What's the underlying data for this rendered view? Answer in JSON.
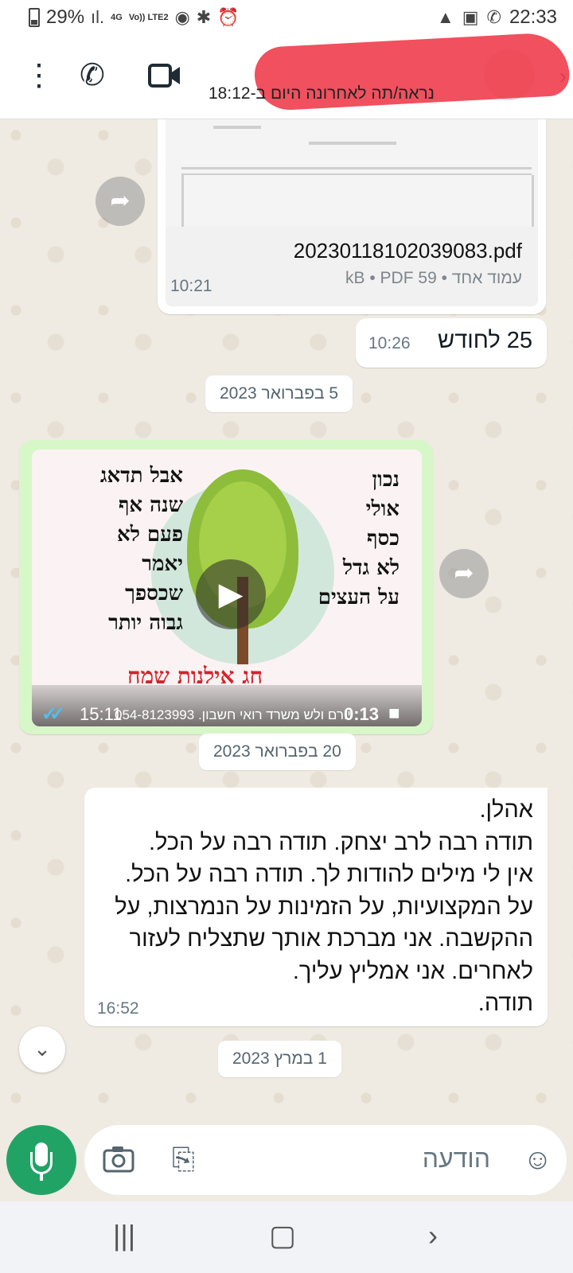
{
  "status": {
    "battery": "29%",
    "network": "4G",
    "volte": "Vo)) LTE2",
    "time": "22:33"
  },
  "header": {
    "last_seen": "נראה/תה לאחרונה היום ב-18:12"
  },
  "messages": {
    "pdf": {
      "filename": "20230118102039083.pdf",
      "info": "עמוד אחד • 59 kB • PDF",
      "time": "10:21"
    },
    "m25": {
      "text": "25 לחודש",
      "time": "10:26"
    },
    "date1": "5 בפברואר 2023",
    "video": {
      "duration": "0:13",
      "info": "יורם ולש משרד רואי חשבון. 054-8123993",
      "time": "15:11",
      "text_right": [
        "נכון",
        "אולי",
        "כסף",
        "לא גדל",
        "על העצים"
      ],
      "text_left": [
        "אבל תדאג",
        "שנה אף",
        "פעם לא",
        "יאמר",
        "שכספך",
        "גבוה יותר"
      ],
      "caption": "חג אילנות שמח"
    },
    "date2": "20 בפברואר 2023",
    "long": {
      "text": "אהלן.\nתודה רבה לרב יצחק. תודה רבה על הכל.\nאין לי מילים להודות לך. תודה רבה על הכל.\nעל המקצועיות, על הזמינות על הנמרצות, על ההקשבה. אני מברכת אותך שתצליח לעזור לאחרים. אני אמליץ עליך.\nתודה.",
      "time": "16:52"
    },
    "date3": "1 במרץ 2023"
  },
  "composer": {
    "placeholder": "הודעה"
  },
  "icons": {
    "more": "more-vert-icon",
    "call": "phone-icon",
    "video_call": "video-camera-icon",
    "forward": "forward-icon",
    "emoji": "emoji-icon",
    "attach": "paperclip-icon",
    "camera": "camera-icon",
    "mic": "microphone-icon"
  },
  "colors": {
    "accent": "#21a366",
    "chat_bg": "#efeae2",
    "outgoing_bubble": "#d8f7c8",
    "read_ticks": "#53bdeb",
    "redaction": "#ef3d4d"
  }
}
